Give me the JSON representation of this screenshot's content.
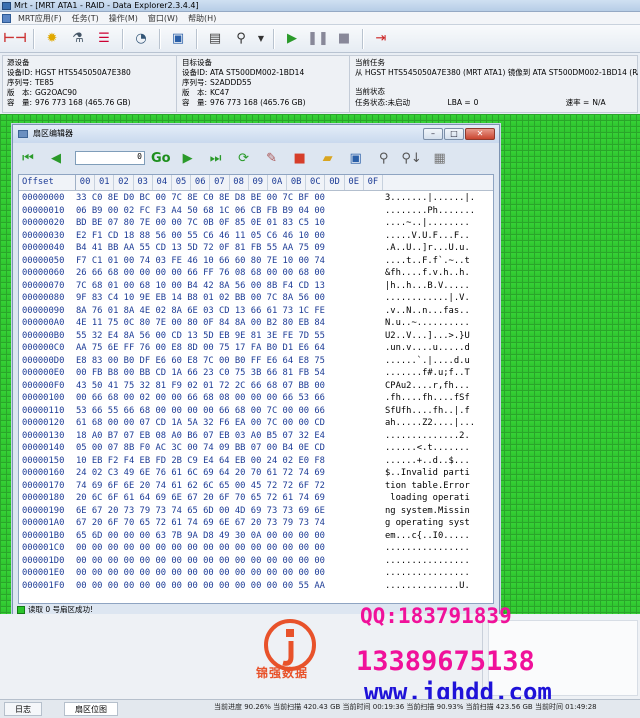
{
  "app": {
    "title": "Mrt - [MRT ATA1 - RAID - Data Explorer2.3.4.4]"
  },
  "menu": [
    "MRT应用(F)",
    "任务(T)",
    "操作(M)",
    "窗口(W)",
    "帮助(H)"
  ],
  "source": {
    "title": "源设备",
    "device_label": "设备ID:",
    "device": "HGST HTS545050A7E380",
    "serial_label": "序列号:",
    "serial": "TE85",
    "version_label": "版　本:",
    "version": "GG2OAC90",
    "capacity_label": "容　量:",
    "capacity": "976 773 168 (465.76 GB)"
  },
  "target": {
    "title": "目标设备",
    "device_label": "设备ID:",
    "device": "ATA ST500DM002-1BD14",
    "serial_label": "序列号:",
    "serial": "S2ADDD55",
    "version_label": "版　本:",
    "version": "KC47",
    "capacity_label": "容　量:",
    "capacity": "976 773 168 (465.76 GB)"
  },
  "task": {
    "title": "当前任务",
    "desc": "从 HGST HTS545050A7E380 (MRT ATA1) 镜像到 ATA ST500DM002-1BD14 (RAID)",
    "state_title": "当前状态",
    "status_label": "任务状态:",
    "status": "未启动",
    "lba_label": "LBA =",
    "lba": "0",
    "speed_label": "速率 =",
    "speed": "N/A"
  },
  "sector_editor": {
    "title": "扇区编辑器",
    "sector_value": "0",
    "go_label": "Go",
    "offset_header": "Offset",
    "columns": [
      "00",
      "01",
      "02",
      "03",
      "04",
      "05",
      "06",
      "07",
      "08",
      "09",
      "0A",
      "0B",
      "0C",
      "0D",
      "0E",
      "0F"
    ],
    "rows": [
      {
        "o": "00000000",
        "h": "33 C0 8E D0 BC 00 7C 8E C0 8E D8 BE 00 7C BF 00",
        "a": "3.......|......|."
      },
      {
        "o": "00000010",
        "h": "06 B9 00 02 FC F3 A4 50 68 1C 06 CB FB B9 04 00",
        "a": "........Ph......."
      },
      {
        "o": "00000020",
        "h": "BD BE 07 80 7E 00 00 7C 0B 0F 85 0E 01 83 C5 10",
        "a": "....~..|........"
      },
      {
        "o": "00000030",
        "h": "E2 F1 CD 18 88 56 00 55 C6 46 11 05 C6 46 10 00",
        "a": ".....V.U.F...F.."
      },
      {
        "o": "00000040",
        "h": "B4 41 BB AA 55 CD 13 5D 72 0F 81 FB 55 AA 75 09",
        "a": ".A..U..]r...U.u."
      },
      {
        "o": "00000050",
        "h": "F7 C1 01 00 74 03 FE 46 10 66 60 80 7E 10 00 74",
        "a": "....t..F.f`.~..t"
      },
      {
        "o": "00000060",
        "h": "26 66 68 00 00 00 00 66 FF 76 08 68 00 00 68 00",
        "a": "&fh....f.v.h..h."
      },
      {
        "o": "00000070",
        "h": "7C 68 01 00 68 10 00 B4 42 8A 56 00 8B F4 CD 13",
        "a": "|h..h...B.V....."
      },
      {
        "o": "00000080",
        "h": "9F 83 C4 10 9E EB 14 B8 01 02 BB 00 7C 8A 56 00",
        "a": "............|.V."
      },
      {
        "o": "00000090",
        "h": "8A 76 01 8A 4E 02 8A 6E 03 CD 13 66 61 73 1C FE",
        "a": ".v..N..n...fas.."
      },
      {
        "o": "000000A0",
        "h": "4E 11 75 0C 80 7E 00 80 0F 84 8A 00 B2 80 EB 84",
        "a": "N.u..~.........."
      },
      {
        "o": "000000B0",
        "h": "55 32 E4 8A 56 00 CD 13 5D EB 9E 81 3E FE 7D 55",
        "a": "U2..V...]...>.}U"
      },
      {
        "o": "000000C0",
        "h": "AA 75 6E FF 76 00 E8 8D 00 75 17 FA B0 D1 E6 64",
        "a": ".un.v....u.....d"
      },
      {
        "o": "000000D0",
        "h": "E8 83 00 B0 DF E6 60 E8 7C 00 B0 FF E6 64 E8 75",
        "a": "......`.|....d.u"
      },
      {
        "o": "000000E0",
        "h": "00 FB B8 00 BB CD 1A 66 23 C0 75 3B 66 81 FB 54",
        "a": ".......f#.u;f..T"
      },
      {
        "o": "000000F0",
        "h": "43 50 41 75 32 81 F9 02 01 72 2C 66 68 07 BB 00",
        "a": "CPAu2....r,fh..."
      },
      {
        "o": "00000100",
        "h": "00 66 68 00 02 00 00 66 68 08 00 00 00 66 53 66",
        "a": ".fh....fh....fSf"
      },
      {
        "o": "00000110",
        "h": "53 66 55 66 68 00 00 00 00 66 68 00 7C 00 00 66",
        "a": "SfUfh....fh..|.f"
      },
      {
        "o": "00000120",
        "h": "61 68 00 00 07 CD 1A 5A 32 F6 EA 00 7C 00 00 CD",
        "a": "ah.....Z2....|..."
      },
      {
        "o": "00000130",
        "h": "18 A0 B7 07 EB 08 A0 B6 07 EB 03 A0 B5 07 32 E4",
        "a": "..............2."
      },
      {
        "o": "00000140",
        "h": "05 00 07 8B F0 AC 3C 00 74 09 BB 07 00 B4 0E CD",
        "a": "......<.t......."
      },
      {
        "o": "00000150",
        "h": "10 EB F2 F4 EB FD 2B C9 E4 64 EB 00 24 02 E0 F8",
        "a": "......+..d..$..."
      },
      {
        "o": "00000160",
        "h": "24 02 C3 49 6E 76 61 6C 69 64 20 70 61 72 74 69",
        "a": "$..Invalid parti"
      },
      {
        "o": "00000170",
        "h": "74 69 6F 6E 20 74 61 62 6C 65 00 45 72 72 6F 72",
        "a": "tion table.Error"
      },
      {
        "o": "00000180",
        "h": "20 6C 6F 61 64 69 6E 67 20 6F 70 65 72 61 74 69",
        "a": " loading operati"
      },
      {
        "o": "00000190",
        "h": "6E 67 20 73 79 73 74 65 6D 00 4D 69 73 73 69 6E",
        "a": "ng system.Missin"
      },
      {
        "o": "000001A0",
        "h": "67 20 6F 70 65 72 61 74 69 6E 67 20 73 79 73 74",
        "a": "g operating syst"
      },
      {
        "o": "000001B0",
        "h": "65 6D 00 00 00 63 7B 9A D8 49 30 0A 00 00 00 00",
        "a": "em...c{..I0....."
      },
      {
        "o": "000001C0",
        "h": "00 00 00 00 00 00 00 00 00 00 00 00 00 00 00 00",
        "a": "................"
      },
      {
        "o": "000001D0",
        "h": "00 00 00 00 00 00 00 00 00 00 00 00 00 00 00 00",
        "a": "................"
      },
      {
        "o": "000001E0",
        "h": "00 00 00 00 00 00 00 00 00 00 00 00 00 00 00 00",
        "a": "................"
      },
      {
        "o": "000001F0",
        "h": "00 00 00 00 00 00 00 00 00 00 00 00 00 00 55 AA",
        "a": "..............U."
      }
    ],
    "status": "读取 0 号扇区成功!"
  },
  "tabs": {
    "log": "日志",
    "sector_map": "扇区位图"
  },
  "bottom_status": "当前进度 90.26%  当前扫描 420.43 GB  当前时间 00:19:36  当前扫描 90.93%  当前扫描 423.56 GB  当前时间 01:49:28",
  "watermark": {
    "qq": "QQ:183791839",
    "phone": "13389675138",
    "url": "www.jqhdd.com",
    "brand": "锦强数据"
  },
  "colors": {
    "grid_green": "#33cc33",
    "hex_blue": "#1d3c96",
    "watermark_pink": "#f0119a",
    "watermark_blue": "#1e12d8"
  }
}
